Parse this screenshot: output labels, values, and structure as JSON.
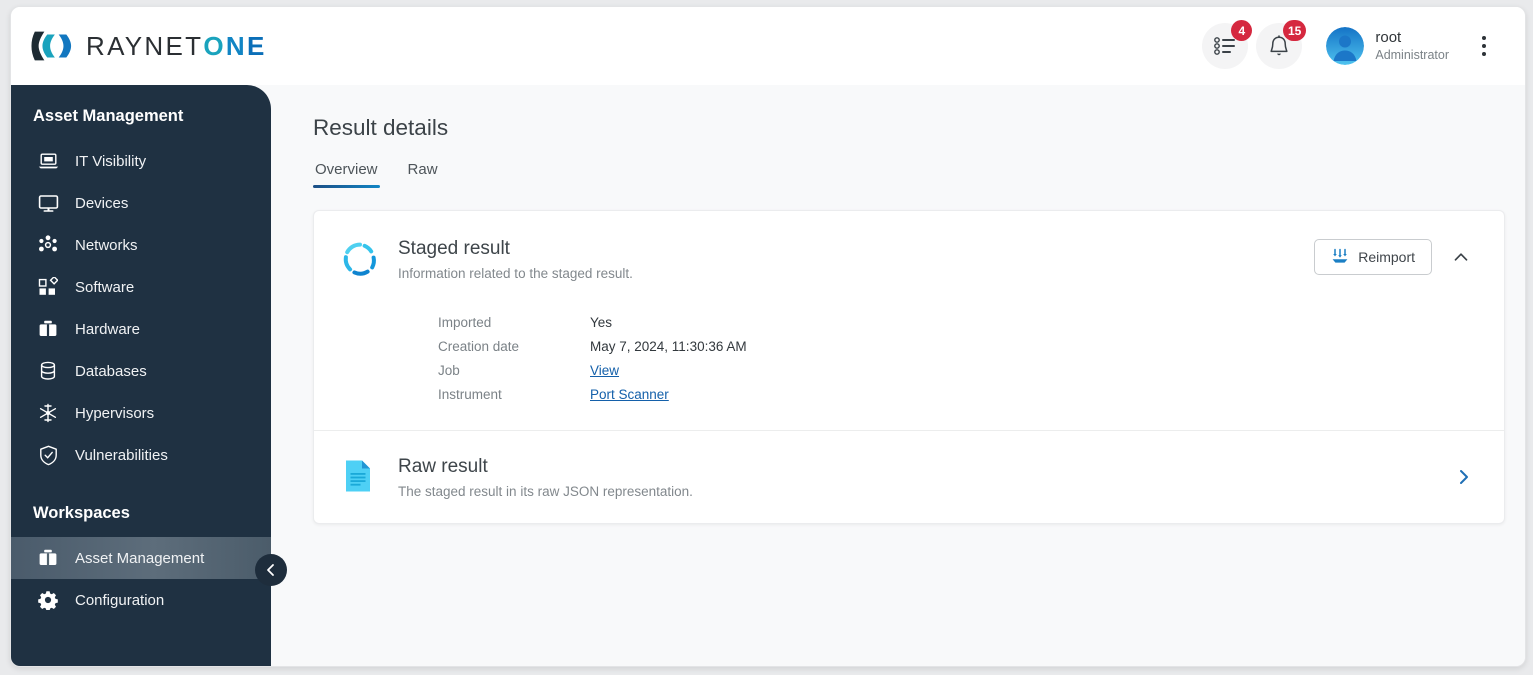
{
  "brand": {
    "name_dark": "RAYNET",
    "name_o": "O",
    "name_n": "N",
    "name_e": "E",
    "logo_icon": "raynet-logo-icon",
    "accent_teal": "#1aa3bd",
    "accent_blue": "#1285c4"
  },
  "header": {
    "tasks": {
      "icon": "task-list-icon",
      "badge": "4"
    },
    "notifications": {
      "icon": "bell-icon",
      "badge": "15"
    },
    "user": {
      "name": "root",
      "role": "Administrator",
      "avatar_icon": "avatar-icon"
    },
    "overflow_icon": "kebab-menu-icon"
  },
  "sidebar": {
    "section_title": "Asset Management",
    "items": [
      {
        "label": "IT Visibility",
        "icon": "laptop-icon"
      },
      {
        "label": "Devices",
        "icon": "monitor-icon"
      },
      {
        "label": "Networks",
        "icon": "network-icon"
      },
      {
        "label": "Software",
        "icon": "software-blocks-icon"
      },
      {
        "label": "Hardware",
        "icon": "toolbox-icon"
      },
      {
        "label": "Databases",
        "icon": "database-icon"
      },
      {
        "label": "Hypervisors",
        "icon": "hypervisor-icon"
      },
      {
        "label": "Vulnerabilities",
        "icon": "shield-check-icon"
      }
    ],
    "workspaces_title": "Workspaces",
    "workspaces": [
      {
        "label": "Asset Management",
        "icon": "toolbox-icon",
        "active": true
      },
      {
        "label": "Configuration",
        "icon": "gear-icon",
        "active": false
      }
    ],
    "collapse_icon": "chevron-left-icon"
  },
  "main": {
    "page_title": "Result details",
    "tabs": [
      {
        "label": "Overview",
        "active": true
      },
      {
        "label": "Raw",
        "active": false
      }
    ],
    "staged": {
      "icon": "spinner-circle-icon",
      "title": "Staged result",
      "subtitle": "Information related to the staged result.",
      "reimport_label": "Reimport",
      "reimport_icon": "import-icon",
      "collapse_icon": "chevron-up-icon",
      "details": [
        {
          "label": "Imported",
          "value": "Yes",
          "link": false
        },
        {
          "label": "Creation date",
          "value": "May 7, 2024, 11:30:36 AM",
          "link": false
        },
        {
          "label": "Job",
          "value": "View",
          "link": true
        },
        {
          "label": "Instrument",
          "value": "Port Scanner",
          "link": true
        }
      ]
    },
    "raw": {
      "icon": "json-document-icon",
      "title": "Raw result",
      "subtitle": "The staged result in its raw JSON representation.",
      "chevron_icon": "chevron-right-icon"
    }
  }
}
